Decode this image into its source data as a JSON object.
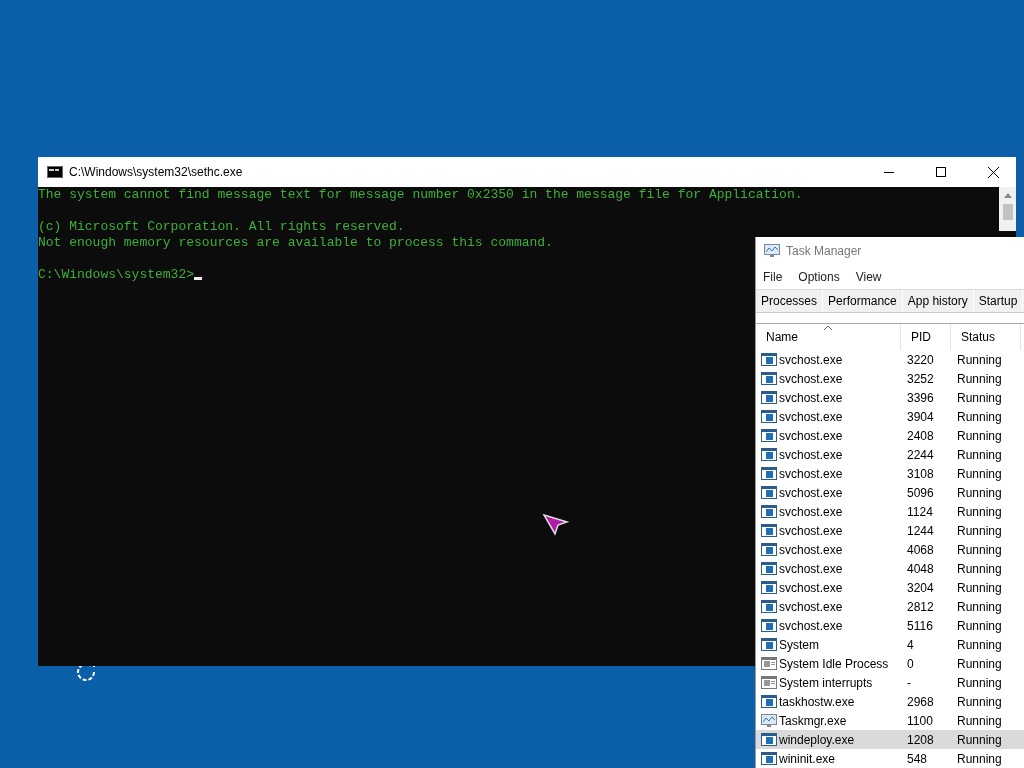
{
  "console_window": {
    "title": "C:\\Windows\\system32\\sethc.exe",
    "blocks": [
      [
        "The system cannot find message text for message number 0x2350 in the message file for Application."
      ],
      [
        "(c) Microsoft Corporation. All rights reserved.",
        "Not enough memory resources are available to process this command."
      ]
    ],
    "prompt": "C:\\Windows\\system32>"
  },
  "task_manager": {
    "title": "Task Manager",
    "menu": [
      "File",
      "Options",
      "View"
    ],
    "tabs": [
      {
        "label": "Processes",
        "selected": false
      },
      {
        "label": "Performance",
        "selected": false
      },
      {
        "label": "App history",
        "selected": false
      },
      {
        "label": "Startup",
        "selected": false
      }
    ],
    "columns": [
      "Name",
      "PID",
      "Status"
    ],
    "rows": [
      {
        "name": "svchost.exe",
        "pid": "3220",
        "status": "Running",
        "kind": "service",
        "selected": false
      },
      {
        "name": "svchost.exe",
        "pid": "3252",
        "status": "Running",
        "kind": "service",
        "selected": false
      },
      {
        "name": "svchost.exe",
        "pid": "3396",
        "status": "Running",
        "kind": "service",
        "selected": false
      },
      {
        "name": "svchost.exe",
        "pid": "3904",
        "status": "Running",
        "kind": "service",
        "selected": false
      },
      {
        "name": "svchost.exe",
        "pid": "2408",
        "status": "Running",
        "kind": "service",
        "selected": false
      },
      {
        "name": "svchost.exe",
        "pid": "2244",
        "status": "Running",
        "kind": "service",
        "selected": false
      },
      {
        "name": "svchost.exe",
        "pid": "3108",
        "status": "Running",
        "kind": "service",
        "selected": false
      },
      {
        "name": "svchost.exe",
        "pid": "5096",
        "status": "Running",
        "kind": "service",
        "selected": false
      },
      {
        "name": "svchost.exe",
        "pid": "1124",
        "status": "Running",
        "kind": "service",
        "selected": false
      },
      {
        "name": "svchost.exe",
        "pid": "1244",
        "status": "Running",
        "kind": "service",
        "selected": false
      },
      {
        "name": "svchost.exe",
        "pid": "4068",
        "status": "Running",
        "kind": "service",
        "selected": false
      },
      {
        "name": "svchost.exe",
        "pid": "4048",
        "status": "Running",
        "kind": "service",
        "selected": false
      },
      {
        "name": "svchost.exe",
        "pid": "3204",
        "status": "Running",
        "kind": "service",
        "selected": false
      },
      {
        "name": "svchost.exe",
        "pid": "2812",
        "status": "Running",
        "kind": "service",
        "selected": false
      },
      {
        "name": "svchost.exe",
        "pid": "5116",
        "status": "Running",
        "kind": "service",
        "selected": false
      },
      {
        "name": "System",
        "pid": "4",
        "status": "Running",
        "kind": "service",
        "selected": false
      },
      {
        "name": "System Idle Process",
        "pid": "0",
        "status": "Running",
        "kind": "system",
        "selected": false
      },
      {
        "name": "System interrupts",
        "pid": "-",
        "status": "Running",
        "kind": "system",
        "selected": false
      },
      {
        "name": "taskhostw.exe",
        "pid": "2968",
        "status": "Running",
        "kind": "service",
        "selected": false
      },
      {
        "name": "Taskmgr.exe",
        "pid": "1100",
        "status": "Running",
        "kind": "monitor",
        "selected": false
      },
      {
        "name": "windeploy.exe",
        "pid": "1208",
        "status": "Running",
        "kind": "service",
        "selected": true
      },
      {
        "name": "wininit.exe",
        "pid": "548",
        "status": "Running",
        "kind": "service",
        "selected": false
      }
    ]
  }
}
